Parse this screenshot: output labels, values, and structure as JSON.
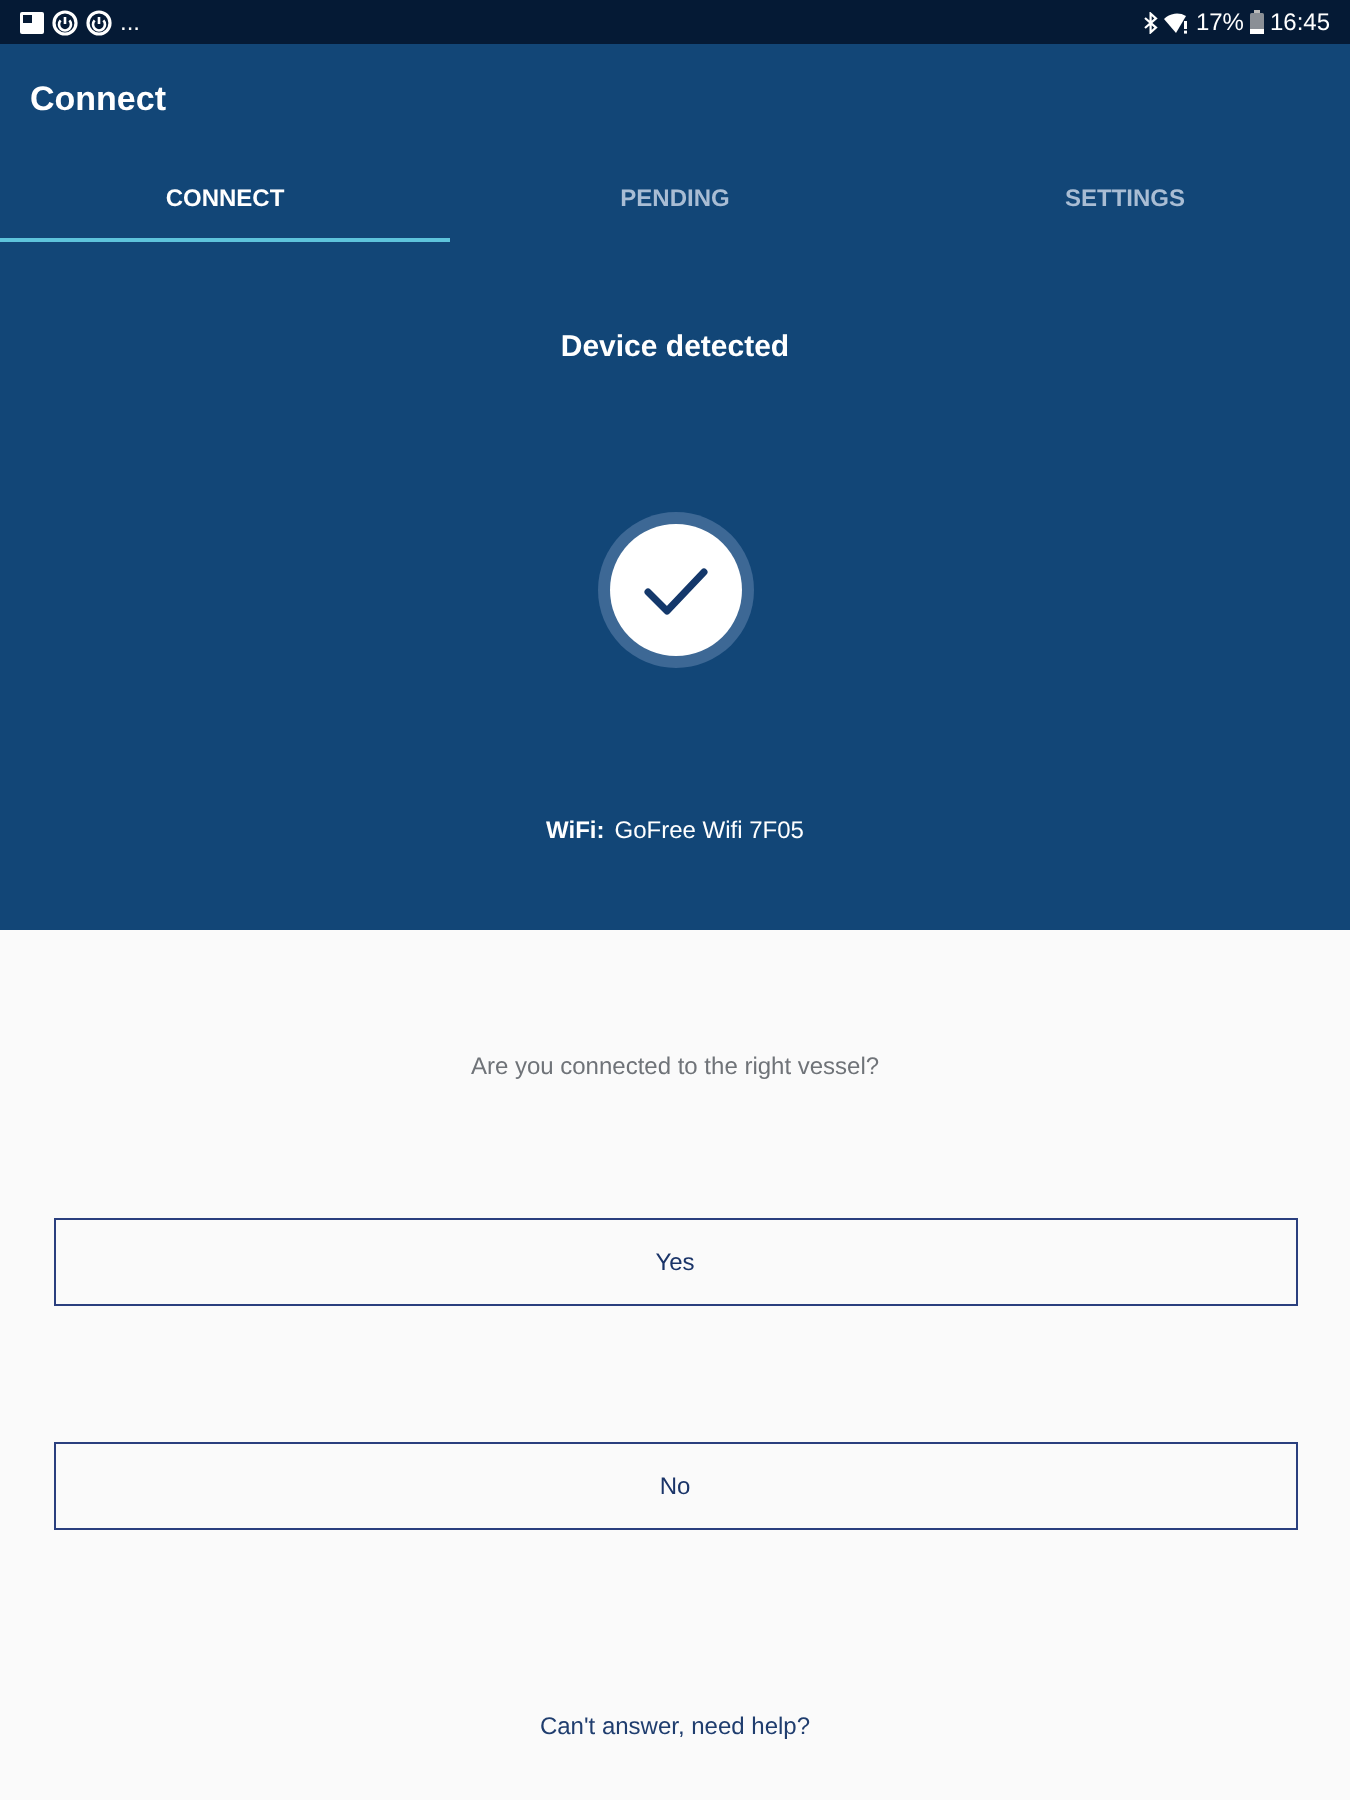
{
  "status_bar": {
    "overflow": "...",
    "battery": "17%",
    "time": "16:45"
  },
  "app_bar": {
    "title": "Connect"
  },
  "tabs": [
    {
      "label": "CONNECT",
      "selected": true
    },
    {
      "label": "PENDING",
      "selected": false
    },
    {
      "label": "SETTINGS",
      "selected": false
    }
  ],
  "device": {
    "heading": "Device detected",
    "wifi_label": "WiFi:",
    "wifi_name": "GoFree Wifi 7F05"
  },
  "question": "Are you connected to the right vessel?",
  "answers": [
    "Yes",
    "No"
  ],
  "help_link": "Can't answer, need help?"
}
